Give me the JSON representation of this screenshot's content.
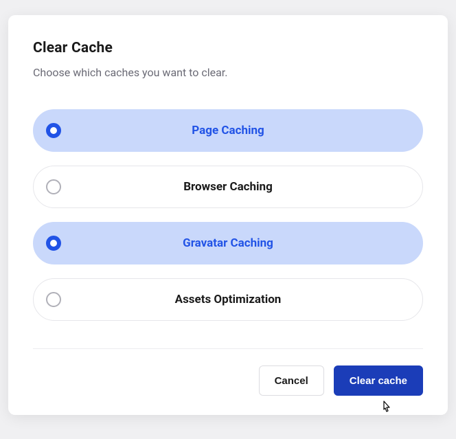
{
  "modal": {
    "title": "Clear Cache",
    "subtitle": "Choose which caches you want to clear.",
    "options": [
      {
        "label": "Page Caching",
        "selected": true
      },
      {
        "label": "Browser Caching",
        "selected": false
      },
      {
        "label": "Gravatar Caching",
        "selected": true
      },
      {
        "label": "Assets Optimization",
        "selected": false
      }
    ],
    "cancel_label": "Cancel",
    "confirm_label": "Clear cache"
  }
}
